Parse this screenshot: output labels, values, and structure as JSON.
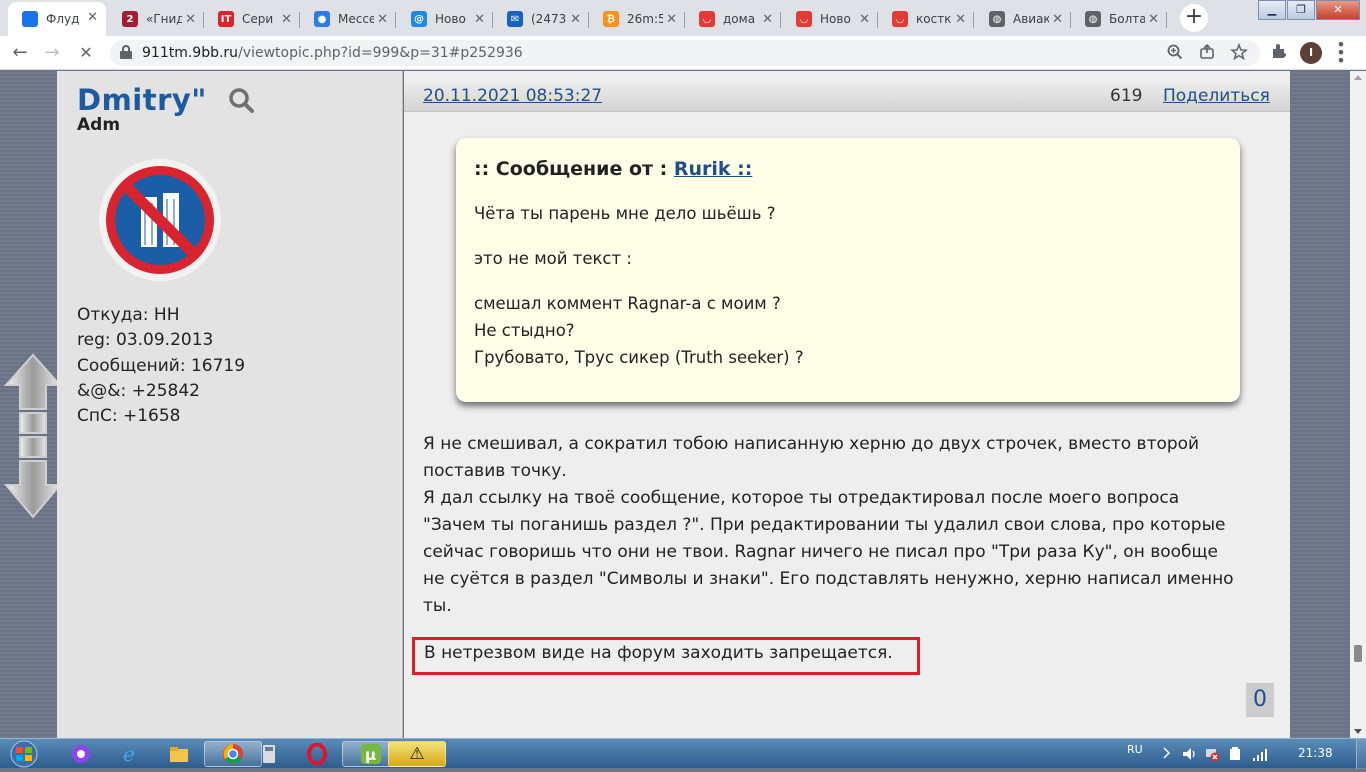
{
  "browser": {
    "tabs": [
      {
        "title": "Флуд",
        "favicon_color": "#1a73e8",
        "favicon_text": "",
        "active": true
      },
      {
        "title": "«Гнид",
        "favicon_color": "#a31c33",
        "favicon_text": "2"
      },
      {
        "title": "Сери",
        "favicon_color": "#e0222b",
        "favicon_text": "IT"
      },
      {
        "title": "Мессе",
        "favicon_color": "#2d7de8",
        "favicon_text": "●"
      },
      {
        "title": "Ново",
        "favicon_color": "#1e88e5",
        "favicon_text": "@"
      },
      {
        "title": "(2473)",
        "favicon_color": "#1565c0",
        "favicon_text": "✉"
      },
      {
        "title": "26m:5",
        "favicon_color": "#f7931a",
        "favicon_text": "₿"
      },
      {
        "title": "дома",
        "favicon_color": "#e53935",
        "favicon_text": "◡"
      },
      {
        "title": "Ново",
        "favicon_color": "#e53935",
        "favicon_text": "◡"
      },
      {
        "title": "костк",
        "favicon_color": "#e53935",
        "favicon_text": "◡"
      },
      {
        "title": "Авиак",
        "favicon_color": "#5f6368",
        "favicon_text": "◍"
      },
      {
        "title": "Болта",
        "favicon_color": "#5f6368",
        "favicon_text": "◍"
      }
    ],
    "close_glyph": "✕",
    "new_tab_glyph": "+",
    "window_buttons": {
      "minimize": "▁",
      "maximize": "❐",
      "close": "✕"
    },
    "url_host": "911tm.9bb.ru",
    "url_path": "/viewtopic.php?id=999&p=31#p252936",
    "profile_initial": "I",
    "nav": {
      "back": "←",
      "forward": "→",
      "stop": "✕"
    }
  },
  "sidebar": {
    "username": "Dmitry\"",
    "role": "Adm",
    "info": [
      "Откуда: НН",
      "reg: 03.09.2013",
      "Сообщений: 16719",
      "&@&: +25842",
      "СпС: +1658"
    ]
  },
  "post": {
    "date": "20.11.2021 08:53:27",
    "number": "619",
    "share_label": "Поделиться",
    "quote": {
      "prefix": ":: Сообщение от : ",
      "author": "Rurik ::",
      "paragraphs": [
        [
          "Чёта ты парень мне дело шьёшь ?"
        ],
        [
          "это не мой текст :"
        ],
        [
          "смешал коммент Ragnar-а  с моим ?",
          "Не стыдно?",
          "Грубовато, Трус сикер (Truth seeker) ?"
        ]
      ]
    },
    "body_lines": [
      "Я не смешивал, а сократил тобою написанную херню до двух строчек, вместо второй",
      "поставив точку.",
      "Я дал ссылку на твоё сообщение, которое ты отредактировал после моего вопроса",
      "\"Зачем ты поганишь раздел ?\". При редактировании ты удалил свои слова, про которые",
      "сейчас говоришь что они не твои. Ragnar ничего не писал про \"Три раза Ку\", он вообще",
      "не суётся в раздел \"Символы и знаки\". Его подставлять ненужно, херню написал именно",
      "ты."
    ],
    "highlight_text": "В нетрезвом виде на форум заходить запрещается.",
    "like_count": "0"
  },
  "taskbar": {
    "language": "RU",
    "time": "21:38",
    "warning_glyph": "⚠"
  }
}
